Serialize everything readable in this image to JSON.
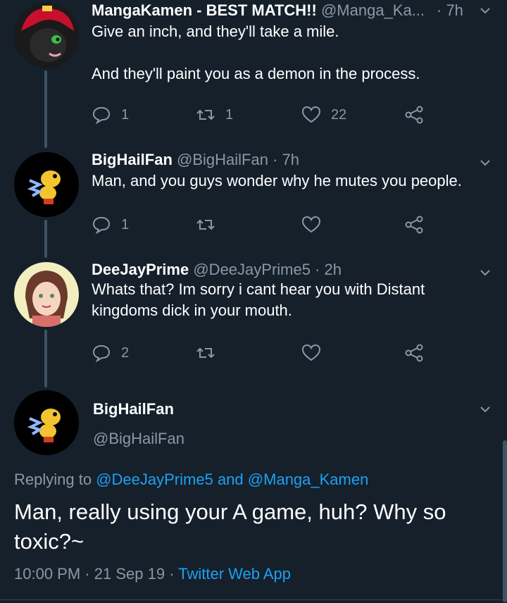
{
  "tweets": [
    {
      "name": "MangaKamen - BEST MATCH!!",
      "handle": "@Manga_Ka...",
      "time": "· 7h",
      "text": "Give an inch, and they'll take a mile.\n\nAnd they'll paint you as a demon in the process.",
      "replies": "1",
      "retweets": "1",
      "likes": "22"
    },
    {
      "name": "BigHailFan",
      "handle": "@BigHailFan",
      "time": "· 7h",
      "text": "Man, and you guys wonder why he mutes you people.",
      "replies": "1",
      "retweets": "",
      "likes": ""
    },
    {
      "name": "DeeJayPrime",
      "handle": "@DeeJayPrime5",
      "time": "· 2h",
      "text": "Whats that? Im sorry i cant hear you with Distant kingdoms dick in your mouth.",
      "replies": "2",
      "retweets": "",
      "likes": ""
    }
  ],
  "focused": {
    "name": "BigHailFan",
    "handle": "@BigHailFan",
    "replying_prefix": "Replying to",
    "reply_user1": "@DeeJayPrime5",
    "reply_and": "and",
    "reply_user2": "@Manga_Kamen",
    "text": "Man, really using your A game, huh?  Why so toxic?~",
    "time": "10:00 PM",
    "date": "21 Sep 19",
    "sep": "·",
    "source": "Twitter Web App"
  },
  "colors": {
    "background": "#15202b",
    "secondary_text": "#8899a6",
    "link": "#1da1f2"
  },
  "icons": [
    "reply-icon",
    "retweet-icon",
    "like-icon",
    "share-icon",
    "chevron-down-icon"
  ]
}
